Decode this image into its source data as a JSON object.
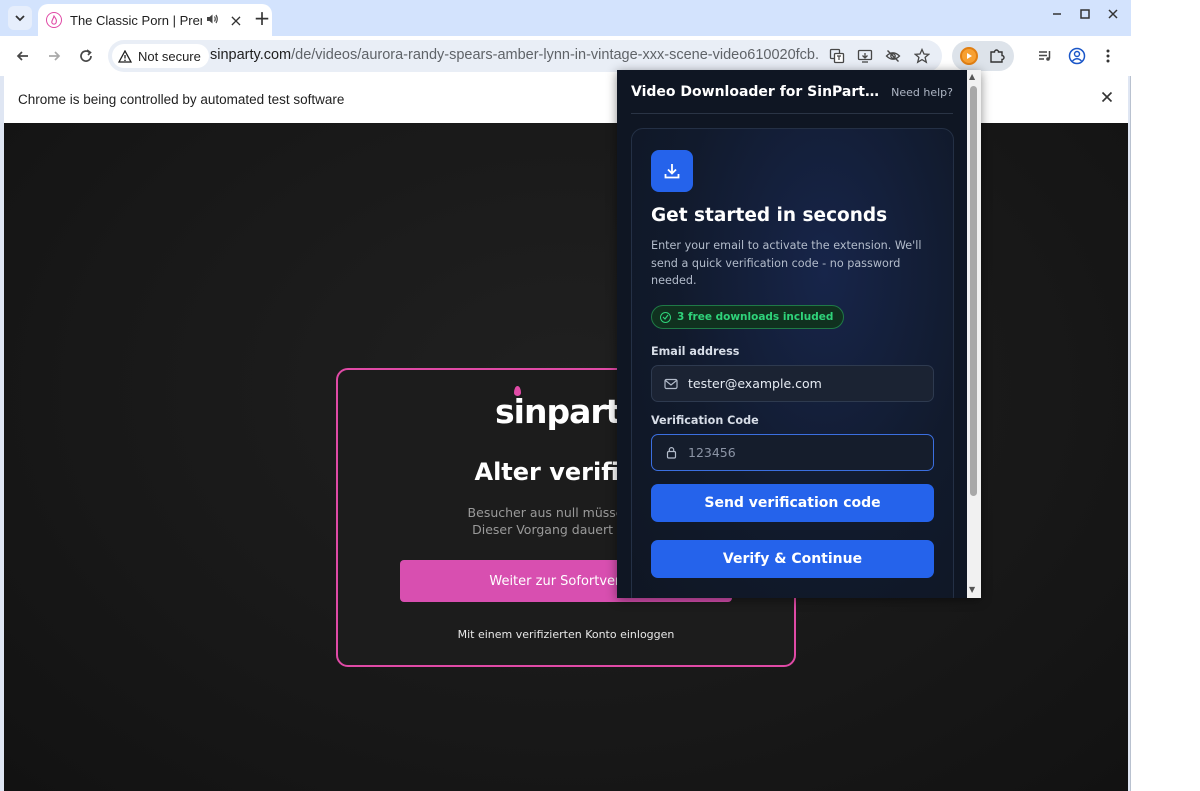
{
  "browser": {
    "tab_title": "The Classic Porn | Premium",
    "new_tab": "+",
    "url_host": "sinparty.com",
    "url_path": "/de/videos/aurora-randy-spears-amber-lynn-in-vintage-xxx-scene-video610020fcb...",
    "security_label": "Not secure",
    "infobar_text": "Chrome is being controlled by automated test software"
  },
  "site": {
    "logo": "sinparty",
    "modal_title": "Alter verifizie",
    "modal_desc_line1": "Besucher aus null müssen ihr A",
    "modal_desc_line2": "Dieser Vorgang dauert nur we",
    "modal_button": "Weiter zur Sofortverifizi",
    "modal_link": "Mit einem verifizierten Konto einloggen",
    "accent": "#e04aa6"
  },
  "extension": {
    "title": "Video Downloader for SinParty T...",
    "help": "Need help?",
    "card_title": "Get started in seconds",
    "card_desc": "Enter your email to activate the extension. We'll send a quick verification code - no password needed.",
    "badge": "3 free downloads included",
    "email_label": "Email address",
    "email_value": "tester@example.com",
    "code_label": "Verification Code",
    "code_placeholder": "123456",
    "send_button": "Send verification code",
    "verify_button": "Verify & Continue",
    "accent": "#2563eb",
    "success": "#2fd37a"
  }
}
